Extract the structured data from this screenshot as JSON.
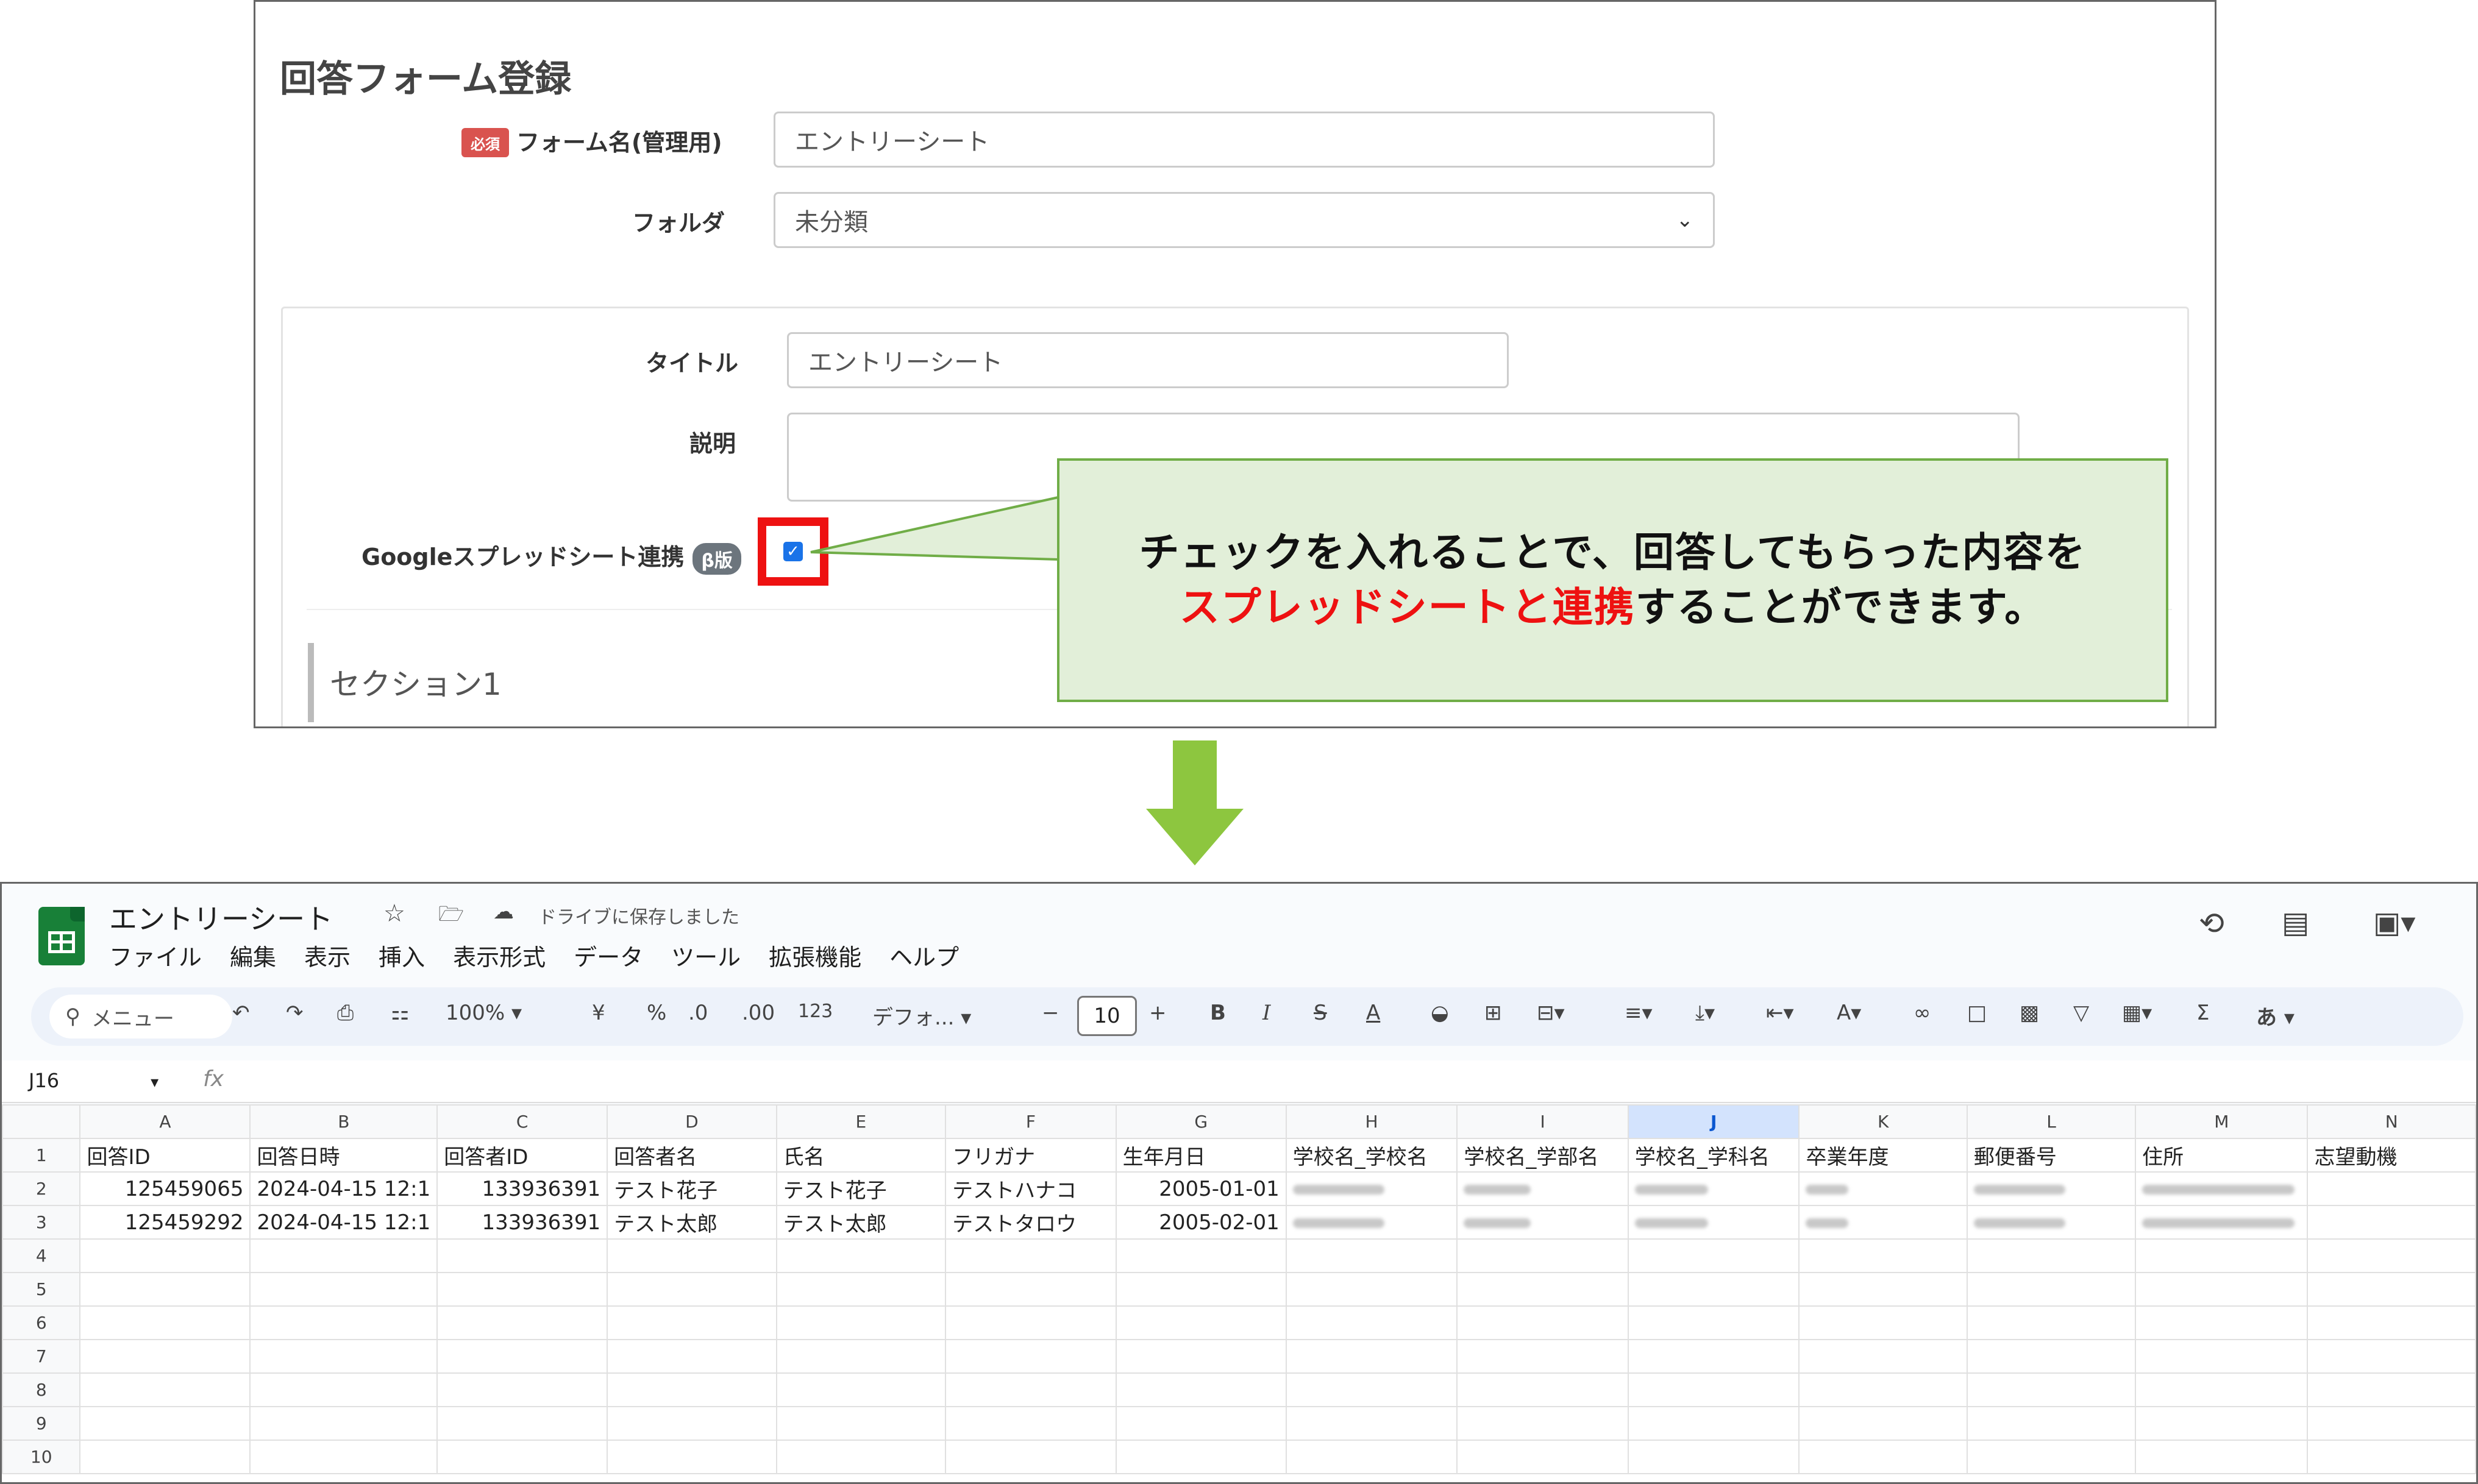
{
  "form": {
    "title": "回答フォーム登録",
    "required_badge": "必須",
    "form_name_label": "フォーム名(管理用)",
    "form_name_value": "エントリーシート",
    "folder_label": "フォルダ",
    "folder_value": "未分類",
    "title_label": "タイトル",
    "title_value": "エントリーシート",
    "description_label": "説明",
    "description_value": "",
    "gsheet_label": "Googleスプレッドシート連携",
    "beta_badge": "β版",
    "gsheet_checked": true,
    "section_title": "セクション1"
  },
  "callout": {
    "line1": "チェックを入れることで、回答してもらった内容を",
    "line2_red": "スプレッドシートと連携",
    "line2_rest": "することができます。"
  },
  "colors": {
    "callout_bg": "#e2efd9",
    "callout_border": "#70ad47",
    "highlight_red": "#ee1111",
    "arrow_green": "#8dc63f"
  },
  "sheet": {
    "doc_title": "エントリーシート",
    "saved_status": "ドライブに保存しました",
    "menu": [
      "ファイル",
      "編集",
      "表示",
      "挿入",
      "表示形式",
      "データ",
      "ツール",
      "拡張機能",
      "ヘルプ"
    ],
    "toolbar": {
      "search": "メニュー",
      "zoom": "100%",
      "currency": "¥",
      "percent": "%",
      "dec_less": ".0",
      "dec_more": ".00",
      "number_format": "123",
      "font": "デフォ...",
      "font_size": "10",
      "input_tool": "あ"
    },
    "name_box": "J16",
    "fx": "fx",
    "columns": [
      "A",
      "B",
      "C",
      "D",
      "E",
      "F",
      "G",
      "H",
      "I",
      "J",
      "K",
      "L",
      "M",
      "N"
    ],
    "selected_column": "J",
    "header_row": [
      "回答ID",
      "回答日時",
      "回答者ID",
      "回答者名",
      "氏名",
      "フリガナ",
      "生年月日",
      "学校名_学校名",
      "学校名_学部名",
      "学校名_学科名",
      "卒業年度",
      "郵便番号",
      "住所",
      "志望動機"
    ],
    "rows": [
      [
        "125459065",
        "2024-04-15 12:1",
        "133936391",
        "テスト花子",
        "テスト花子",
        "テストハナコ",
        "2005-01-01"
      ],
      [
        "125459292",
        "2024-04-15 12:1",
        "133936391",
        "テスト太郎",
        "テスト太郎",
        "テストタロウ",
        "2005-02-01"
      ]
    ],
    "row_numbers": [
      "1",
      "2",
      "3",
      "4",
      "5",
      "6",
      "7",
      "8",
      "9",
      "10"
    ]
  }
}
